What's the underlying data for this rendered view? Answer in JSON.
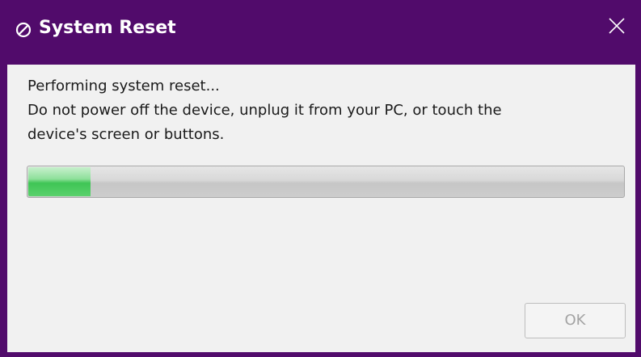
{
  "window": {
    "title": "System Reset",
    "title_icon": "no-entry-icon",
    "close_icon": "close-icon",
    "accent_color": "#510b6b"
  },
  "message": {
    "line1": "Performing system reset...",
    "line2": "Do not power off the device, unplug it from your PC, or touch the",
    "line3": "device's screen or buttons."
  },
  "progress": {
    "value_percent": 10.5,
    "fill_color": "#3fc555"
  },
  "buttons": {
    "ok_label": "OK",
    "ok_enabled": false
  }
}
